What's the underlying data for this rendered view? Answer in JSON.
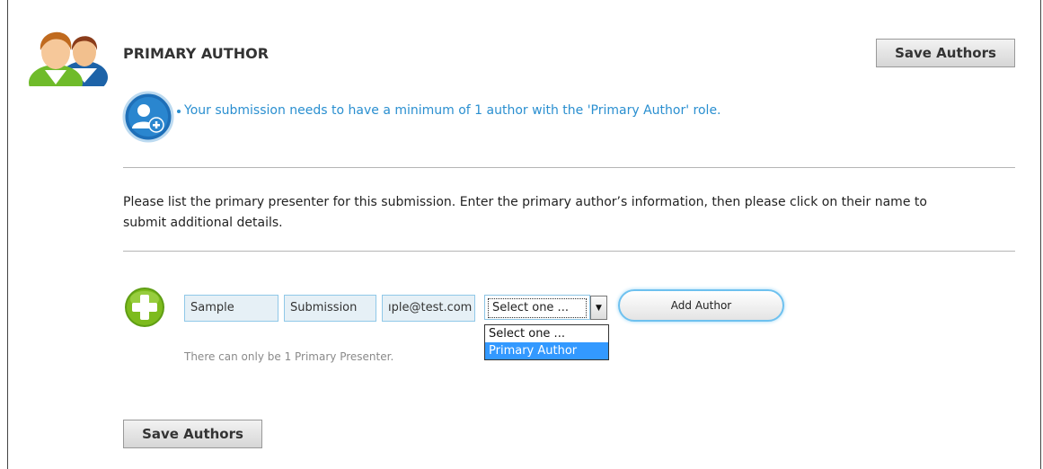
{
  "header": {
    "title": "PRIMARY AUTHOR",
    "save_label": "Save Authors"
  },
  "notice": {
    "text": "Your submission needs to have a minimum of 1 author with the 'Primary Author' role."
  },
  "instructions": {
    "line1": "Please list the primary presenter for this submission. Enter the primary author’s information, then please click on their name to",
    "line2": "submit additional details."
  },
  "author_form": {
    "first_name": "Sample",
    "last_name": "Submission",
    "email": "ıple@test.com",
    "role_selected": "Select one ...",
    "role_options": [
      "Select one ...",
      "Primary Author"
    ],
    "add_label": "Add Author",
    "hint": "There can only be 1 Primary Presenter."
  },
  "footer": {
    "save_label": "Save Authors"
  },
  "colors": {
    "accent_blue": "#2a8fd0",
    "option_highlight": "#3399ff",
    "add_icon_green": "#7dbb1d"
  }
}
